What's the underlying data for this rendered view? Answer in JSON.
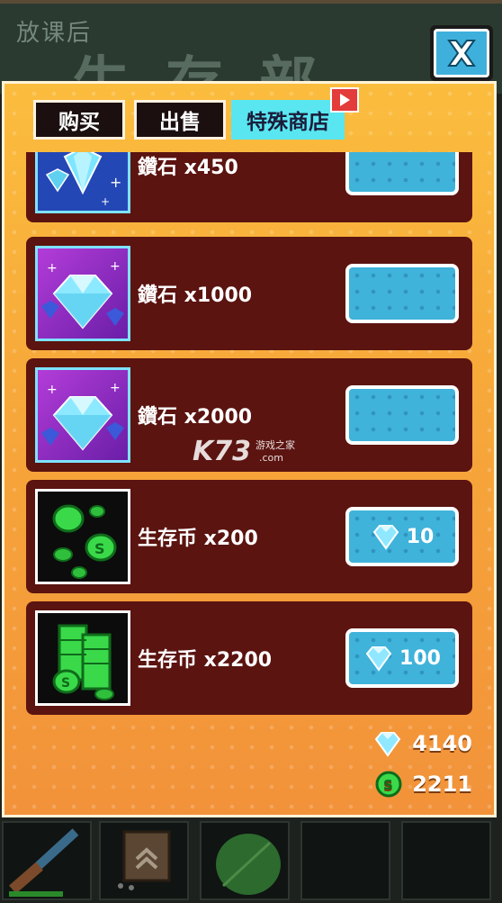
{
  "background": {
    "chalk_small": "放课后",
    "chalk_big": "生存部"
  },
  "close_button": {
    "icon": "close-x-icon"
  },
  "tabs": [
    {
      "label": "购买",
      "active": false
    },
    {
      "label": "出售",
      "active": false
    },
    {
      "label": "特殊商店",
      "active": true
    }
  ],
  "tab_badge_icon": "play-arrow-icon",
  "items": [
    {
      "name": "鑽石 x450",
      "thumb": "diamond-stack-icon",
      "thumb_style": "blue",
      "price": "",
      "price_icon": ""
    },
    {
      "name": "鑽石 x1000",
      "thumb": "diamond-pile-icon",
      "thumb_style": "purple",
      "price": "",
      "price_icon": ""
    },
    {
      "name": "鑽石 x2000",
      "thumb": "diamond-pile-icon",
      "thumb_style": "purple",
      "price": "",
      "price_icon": ""
    },
    {
      "name": "生存币 x200",
      "thumb": "green-coins-icon",
      "thumb_style": "black",
      "price": "10",
      "price_icon": "diamond-icon"
    },
    {
      "name": "生存币 x2200",
      "thumb": "green-coin-stack-icon",
      "thumb_style": "black",
      "price": "100",
      "price_icon": "diamond-icon"
    }
  ],
  "currencies": {
    "diamonds": "4140",
    "coins": "2211"
  },
  "watermark": {
    "brand": "K73",
    "tagline": "游戏之家",
    "domain": ".com"
  },
  "colors": {
    "panel_top": "#fbbd3e",
    "panel_bottom": "#f2923a",
    "item_bg": "#5b1410",
    "button_blue": "#3fb3da",
    "tab_active": "#59e6f0"
  }
}
